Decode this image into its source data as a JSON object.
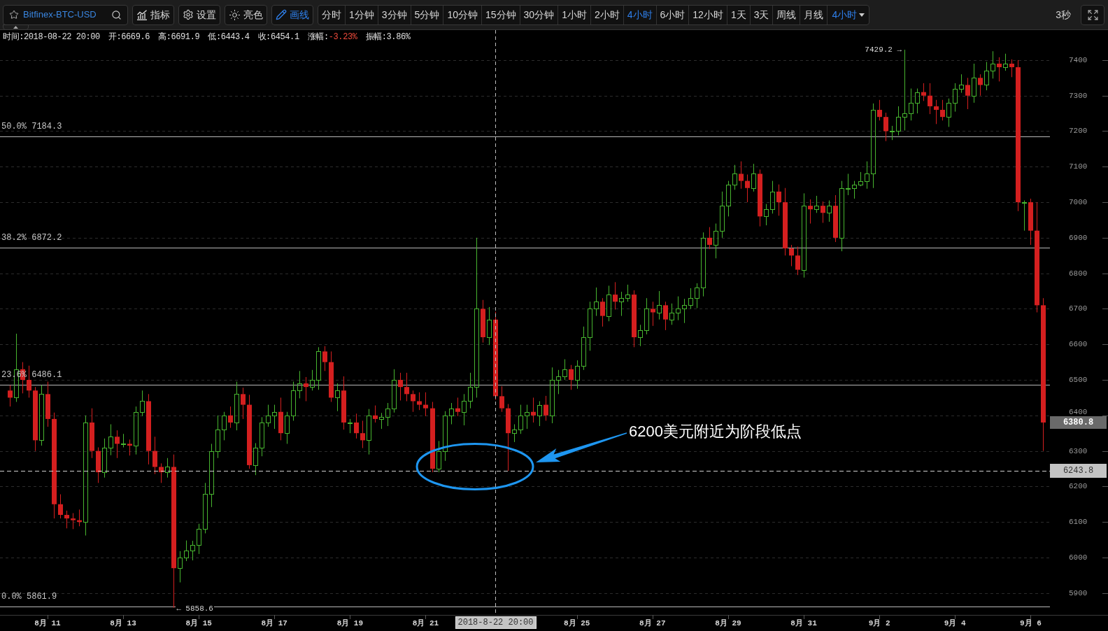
{
  "toolbar": {
    "symbol": "Bitfinex-BTC-USD",
    "tools": [
      {
        "kind": "indicators",
        "label": "指标",
        "active": false
      },
      {
        "kind": "settings",
        "label": "设置",
        "active": false
      },
      {
        "kind": "theme",
        "label": "亮色",
        "active": false
      },
      {
        "kind": "draw",
        "label": "画线",
        "active": true
      }
    ],
    "periods": [
      {
        "label": "分时",
        "selected": false
      },
      {
        "label": "1分钟",
        "selected": false
      },
      {
        "label": "3分钟",
        "selected": false
      },
      {
        "label": "5分钟",
        "selected": false
      },
      {
        "label": "10分钟",
        "selected": false
      },
      {
        "label": "15分钟",
        "selected": false
      },
      {
        "label": "30分钟",
        "selected": false
      },
      {
        "label": "1小时",
        "selected": false
      },
      {
        "label": "2小时",
        "selected": false
      },
      {
        "label": "4小时",
        "selected": true
      },
      {
        "label": "6小时",
        "selected": false
      },
      {
        "label": "12小时",
        "selected": false
      },
      {
        "label": "1天",
        "selected": false
      },
      {
        "label": "3天",
        "selected": false
      },
      {
        "label": "周线",
        "selected": false
      },
      {
        "label": "月线",
        "selected": false
      }
    ],
    "period_menu": {
      "label": "4小时",
      "selected": true
    },
    "refresh": "3秒"
  },
  "ohlc": [
    {
      "label": "时间:",
      "value": "2018-08-22 20:00"
    },
    {
      "label": "开:",
      "value": "6669.6"
    },
    {
      "label": "高:",
      "value": "6691.9"
    },
    {
      "label": "低:",
      "value": "6443.4"
    },
    {
      "label": "收:",
      "value": "6454.1"
    },
    {
      "label": "涨幅:",
      "value": "-3.23%",
      "color": "#f04b3c"
    },
    {
      "label": "振幅:",
      "value": "3.86%"
    }
  ],
  "chart": {
    "chart_data": {
      "type": "candlestick",
      "categories": [
        null,
        null,
        null,
        null,
        null,
        null,
        "8月 11",
        null,
        null,
        null,
        null,
        null,
        null,
        null,
        null,
        null,
        null,
        null,
        "8月 13",
        null,
        null,
        null,
        null,
        null,
        null,
        null,
        null,
        null,
        null,
        null,
        "8月 15",
        null,
        null,
        null,
        null,
        null,
        null,
        null,
        null,
        null,
        null,
        null,
        "8月 17",
        null,
        null,
        null,
        null,
        null,
        null,
        null,
        null,
        null,
        null,
        null,
        "8月 19",
        null,
        null,
        null,
        null,
        null,
        null,
        null,
        null,
        null,
        null,
        null,
        "8月 21",
        null,
        null,
        null,
        null,
        null,
        null,
        null,
        null,
        null,
        null,
        null,
        null,
        null,
        null,
        null,
        null,
        null,
        null,
        null,
        null,
        null,
        null,
        null,
        "8月 25",
        null,
        null,
        null,
        null,
        null,
        null,
        null,
        null,
        null,
        null,
        null,
        "8月 27",
        null,
        null,
        null,
        null,
        null,
        null,
        null,
        null,
        null,
        null,
        null,
        "8月 29",
        null,
        null,
        null,
        null,
        null,
        null,
        null,
        null,
        null,
        null,
        null,
        "8月 31",
        null,
        null,
        null,
        null,
        null,
        null,
        null,
        null,
        null,
        null,
        null,
        "9月 2",
        null,
        null,
        null,
        null,
        null,
        null,
        null,
        null,
        null,
        null,
        null,
        "9月 4",
        null,
        null,
        null,
        null,
        null,
        null,
        null,
        null,
        null,
        null,
        null,
        "9月 6",
        null,
        null
      ],
      "ohlc": [
        [
          6470,
          6485,
          6425,
          6450
        ],
        [
          6450,
          6630,
          6438,
          6530
        ],
        [
          6530,
          6550,
          6462,
          6500
        ],
        [
          6500,
          6540,
          6450,
          6470
        ],
        [
          6470,
          6480,
          6300,
          6330
        ],
        [
          6330,
          6485,
          6315,
          6460
        ],
        [
          6460,
          6495,
          6368,
          6390
        ],
        [
          6390,
          6408,
          6110,
          6150
        ],
        [
          6150,
          6178,
          6110,
          6120
        ],
        [
          6120,
          6132,
          6082,
          6110
        ],
        [
          6110,
          6125,
          6080,
          6105
        ],
        [
          6105,
          6135,
          6088,
          6100
        ],
        [
          6100,
          6400,
          6062,
          6380
        ],
        [
          6380,
          6420,
          6280,
          6300
        ],
        [
          6300,
          6310,
          6210,
          6240
        ],
        [
          6240,
          6335,
          6225,
          6310
        ],
        [
          6310,
          6375,
          6288,
          6340
        ],
        [
          6340,
          6358,
          6280,
          6320
        ],
        [
          6320,
          6348,
          6310,
          6320
        ],
        [
          6320,
          6332,
          6287,
          6315
        ],
        [
          6315,
          6425,
          6290,
          6410
        ],
        [
          6410,
          6470,
          6398,
          6440
        ],
        [
          6440,
          6460,
          6262,
          6300
        ],
        [
          6300,
          6340,
          6235,
          6255
        ],
        [
          6255,
          6265,
          6210,
          6240
        ],
        [
          6240,
          6280,
          6225,
          6255
        ],
        [
          6255,
          6290,
          5858.6,
          5970
        ],
        [
          5970,
          6018,
          5930,
          6000
        ],
        [
          6000,
          6048,
          5990,
          6020
        ],
        [
          6020,
          6047,
          5992,
          6035
        ],
        [
          6035,
          6095,
          6010,
          6080
        ],
        [
          6080,
          6210,
          6068,
          6180
        ],
        [
          6180,
          6320,
          6142,
          6300
        ],
        [
          6300,
          6400,
          6280,
          6360
        ],
        [
          6360,
          6410,
          6330,
          6400
        ],
        [
          6400,
          6425,
          6365,
          6380
        ],
        [
          6380,
          6495,
          6358,
          6460
        ],
        [
          6460,
          6478,
          6390,
          6430
        ],
        [
          6430,
          6458,
          6250,
          6260
        ],
        [
          6260,
          6322,
          6232,
          6310
        ],
        [
          6310,
          6395,
          6285,
          6380
        ],
        [
          6380,
          6430,
          6368,
          6400
        ],
        [
          6400,
          6430,
          6362,
          6410
        ],
        [
          6410,
          6450,
          6330,
          6350
        ],
        [
          6350,
          6410,
          6320,
          6400
        ],
        [
          6400,
          6495,
          6385,
          6470
        ],
        [
          6470,
          6525,
          6448,
          6490
        ],
        [
          6490,
          6508,
          6440,
          6480
        ],
        [
          6480,
          6528,
          6470,
          6500
        ],
        [
          6500,
          6592,
          6472,
          6580
        ],
        [
          6580,
          6595,
          6525,
          6550
        ],
        [
          6550,
          6580,
          6438,
          6450
        ],
        [
          6450,
          6490,
          6412,
          6470
        ],
        [
          6470,
          6510,
          6360,
          6380
        ],
        [
          6380,
          6390,
          6350,
          6380
        ],
        [
          6380,
          6405,
          6335,
          6350
        ],
        [
          6350,
          6385,
          6308,
          6330
        ],
        [
          6330,
          6418,
          6290,
          6400
        ],
        [
          6400,
          6428,
          6380,
          6390
        ],
        [
          6390,
          6407,
          6362,
          6395
        ],
        [
          6395,
          6435,
          6370,
          6420
        ],
        [
          6420,
          6530,
          6408,
          6500
        ],
        [
          6500,
          6520,
          6442,
          6480
        ],
        [
          6480,
          6520,
          6440,
          6460
        ],
        [
          6460,
          6470,
          6410,
          6440
        ],
        [
          6440,
          6465,
          6415,
          6430
        ],
        [
          6430,
          6465,
          6398,
          6420
        ],
        [
          6420,
          6438,
          6240,
          6250
        ],
        [
          6250,
          6328,
          6240,
          6300
        ],
        [
          6300,
          6412,
          6272,
          6400
        ],
        [
          6400,
          6435,
          6375,
          6420
        ],
        [
          6420,
          6450,
          6398,
          6410
        ],
        [
          6410,
          6460,
          6372,
          6440
        ],
        [
          6440,
          6520,
          6420,
          6480
        ],
        [
          6480,
          6900,
          6450,
          6700
        ],
        [
          6700,
          6725,
          6605,
          6620
        ],
        [
          6620,
          6705,
          6598,
          6670
        ],
        [
          6669.6,
          6691.9,
          6443.4,
          6454.1
        ],
        [
          6454,
          6482,
          6410,
          6420
        ],
        [
          6420,
          6432,
          6243.8,
          6350
        ],
        [
          6350,
          6375,
          6325,
          6360
        ],
        [
          6360,
          6430,
          6348,
          6400
        ],
        [
          6400,
          6430,
          6362,
          6410
        ],
        [
          6410,
          6450,
          6380,
          6400
        ],
        [
          6400,
          6440,
          6370,
          6430
        ],
        [
          6430,
          6455,
          6385,
          6400
        ],
        [
          6400,
          6535,
          6378,
          6500
        ],
        [
          6500,
          6528,
          6460,
          6510
        ],
        [
          6510,
          6558,
          6500,
          6530
        ],
        [
          6530,
          6542,
          6472,
          6500
        ],
        [
          6500,
          6555,
          6475,
          6540
        ],
        [
          6540,
          6650,
          6528,
          6620
        ],
        [
          6620,
          6720,
          6582,
          6700
        ],
        [
          6700,
          6760,
          6680,
          6720
        ],
        [
          6720,
          6730,
          6650,
          6680
        ],
        [
          6680,
          6765,
          6665,
          6740
        ],
        [
          6740,
          6775,
          6698,
          6720
        ],
        [
          6720,
          6748,
          6680,
          6730
        ],
        [
          6730,
          6768,
          6720,
          6740
        ],
        [
          6740,
          6752,
          6592,
          6620
        ],
        [
          6620,
          6655,
          6595,
          6640
        ],
        [
          6640,
          6730,
          6628,
          6700
        ],
        [
          6700,
          6720,
          6652,
          6690
        ],
        [
          6690,
          6750,
          6670,
          6710
        ],
        [
          6710,
          6720,
          6640,
          6670
        ],
        [
          6670,
          6715,
          6655,
          6690
        ],
        [
          6690,
          6735,
          6668,
          6700
        ],
        [
          6700,
          6728,
          6660,
          6710
        ],
        [
          6710,
          6758,
          6700,
          6730
        ],
        [
          6730,
          6772,
          6702,
          6760
        ],
        [
          6760,
          6915,
          6735,
          6900
        ],
        [
          6900,
          6930,
          6868,
          6880
        ],
        [
          6880,
          6940,
          6842,
          6920
        ],
        [
          6920,
          7030,
          6900,
          6990
        ],
        [
          6990,
          7060,
          6960,
          7050
        ],
        [
          7050,
          7105,
          7035,
          7080
        ],
        [
          7080,
          7115,
          7038,
          7060
        ],
        [
          7060,
          7078,
          7000,
          7040
        ],
        [
          7040,
          7108,
          7030,
          7080
        ],
        [
          7080,
          7092,
          6932,
          6960
        ],
        [
          6960,
          6995,
          6935,
          6980
        ],
        [
          6980,
          7060,
          6968,
          7030
        ],
        [
          7030,
          7050,
          6962,
          7000
        ],
        [
          7000,
          7040,
          6850,
          6870
        ],
        [
          6870,
          6880,
          6820,
          6850
        ],
        [
          6850,
          6875,
          6795,
          6810
        ],
        [
          6810,
          7025,
          6788,
          6990
        ],
        [
          6990,
          7008,
          6940,
          6980
        ],
        [
          6980,
          7018,
          6970,
          6990
        ],
        [
          6990,
          7002,
          6942,
          6970
        ],
        [
          6970,
          7005,
          6945,
          6990
        ],
        [
          6990,
          7020,
          6888,
          6900
        ],
        [
          6900,
          7060,
          6862,
          7040
        ],
        [
          7040,
          7080,
          7020,
          7040
        ],
        [
          7040,
          7060,
          7010,
          7050
        ],
        [
          7050,
          7085,
          7045,
          7060
        ],
        [
          7060,
          7115,
          7038,
          7080
        ],
        [
          7080,
          7278,
          7040,
          7260
        ],
        [
          7260,
          7288,
          7230,
          7240
        ],
        [
          7240,
          7252,
          7172,
          7200
        ],
        [
          7200,
          7215,
          7175,
          7200
        ],
        [
          7200,
          7270,
          7188,
          7240
        ],
        [
          7240,
          7429.2,
          7202,
          7250
        ],
        [
          7250,
          7320,
          7230,
          7280
        ],
        [
          7280,
          7320,
          7250,
          7310
        ],
        [
          7310,
          7335,
          7285,
          7300
        ],
        [
          7300,
          7335,
          7248,
          7270
        ],
        [
          7270,
          7288,
          7220,
          7260
        ],
        [
          7260,
          7288,
          7230,
          7240
        ],
        [
          7240,
          7292,
          7212,
          7280
        ],
        [
          7280,
          7335,
          7255,
          7320
        ],
        [
          7320,
          7360,
          7308,
          7330
        ],
        [
          7330,
          7350,
          7262,
          7300
        ],
        [
          7300,
          7390,
          7280,
          7350
        ],
        [
          7350,
          7360,
          7300,
          7330
        ],
        [
          7330,
          7395,
          7315,
          7370
        ],
        [
          7370,
          7425,
          7348,
          7390
        ],
        [
          7390,
          7408,
          7340,
          7380
        ],
        [
          7380,
          7418,
          7370,
          7390
        ],
        [
          7390,
          7402,
          7352,
          7380
        ],
        [
          7380,
          7400,
          6975,
          7000
        ],
        [
          7000,
          7005,
          6920,
          7000
        ],
        [
          7000,
          7010,
          6880,
          6920
        ],
        [
          6920,
          7000,
          6690,
          6710
        ],
        [
          6710,
          6730,
          6300,
          6380
        ]
      ],
      "ylim": [
        5838.5,
        7484.5
      ],
      "yticks": [
        7400,
        7300,
        7200,
        7100,
        7000,
        6900,
        6800,
        6700,
        6600,
        6500,
        6400,
        6300,
        6200,
        6100,
        6000,
        5900
      ],
      "grid": true,
      "ref_lines": [
        {
          "axis": "y",
          "value": 7184.3,
          "label": "50.0% 7184.3"
        },
        {
          "axis": "y",
          "value": 6872.2,
          "label": "38.2% 6872.2"
        },
        {
          "axis": "y",
          "value": 6486.1,
          "label": "23.6% 6486.1"
        },
        {
          "axis": "y",
          "value": 5861.9,
          "label": "0.0% 5861.9"
        },
        {
          "axis": "y",
          "value": 6243.8,
          "label": "6243.8"
        }
      ]
    },
    "high_marker": "7429.2 →",
    "low_marker": "← 5858.6",
    "last_price": "6380.8",
    "crosshair": {
      "time": "2018-8-22 20:00"
    },
    "annotation": "6200美元附近为阶段低点"
  }
}
